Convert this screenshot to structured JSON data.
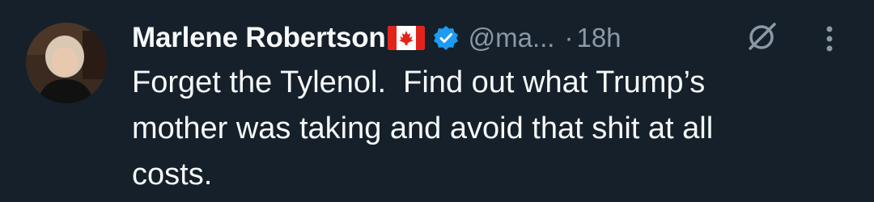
{
  "tweet": {
    "author_name": "Marlene Robertson",
    "author_flag": "canada-flag-emoji",
    "verified_icon": "verified-badge-icon",
    "handle": "@ma...",
    "separator": "·",
    "time": "18h",
    "text": "Forget the Tylenol.  Find out what Trump’s\nmother was taking and avoid that shit at all\ncosts."
  },
  "icons": {
    "grok": "grok-icon",
    "more": "more-options-icon"
  },
  "colors": {
    "background": "#15202b",
    "primary_text": "#f7f9f9",
    "secondary_text": "#8b98a5",
    "verified_blue": "#1d9bf0"
  }
}
